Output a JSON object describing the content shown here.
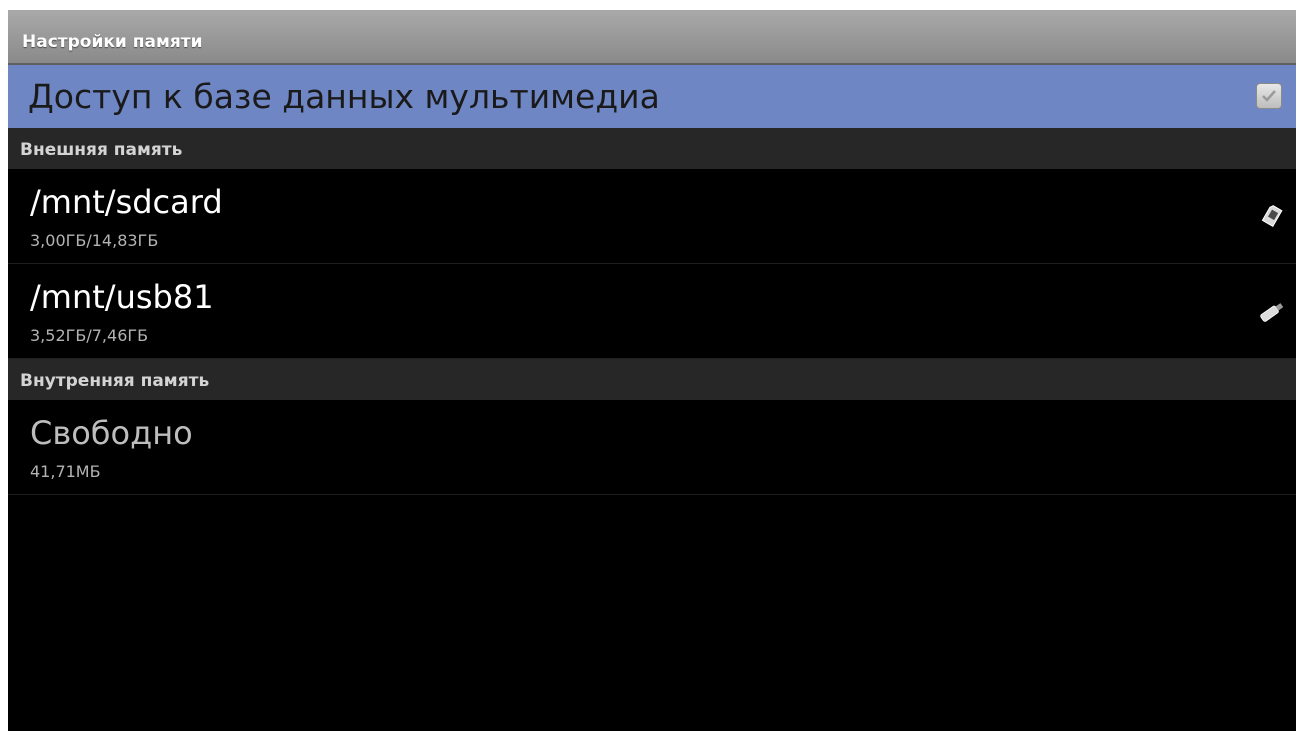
{
  "header": {
    "title": "Настройки памяти"
  },
  "media_db": {
    "label": "Доступ к базе данных мультимедиа",
    "checked": true,
    "icon": "checkbox-icon"
  },
  "sections": {
    "external": {
      "title": "Внешняя память",
      "items": [
        {
          "path": "/mnt/sdcard",
          "usage": "3,00ГБ/14,83ГБ",
          "icon": "sd-card-icon"
        },
        {
          "path": "/mnt/usb81",
          "usage": "3,52ГБ/7,46ГБ",
          "icon": "usb-drive-icon"
        }
      ]
    },
    "internal": {
      "title": "Внутренняя память",
      "items": [
        {
          "label": "Свободно",
          "value": "41,71МБ"
        }
      ]
    }
  },
  "colors": {
    "header_bg": "#9c9c9c",
    "selected_row_bg": "#6f86c4",
    "section_bg": "#272727",
    "background": "#000000"
  }
}
